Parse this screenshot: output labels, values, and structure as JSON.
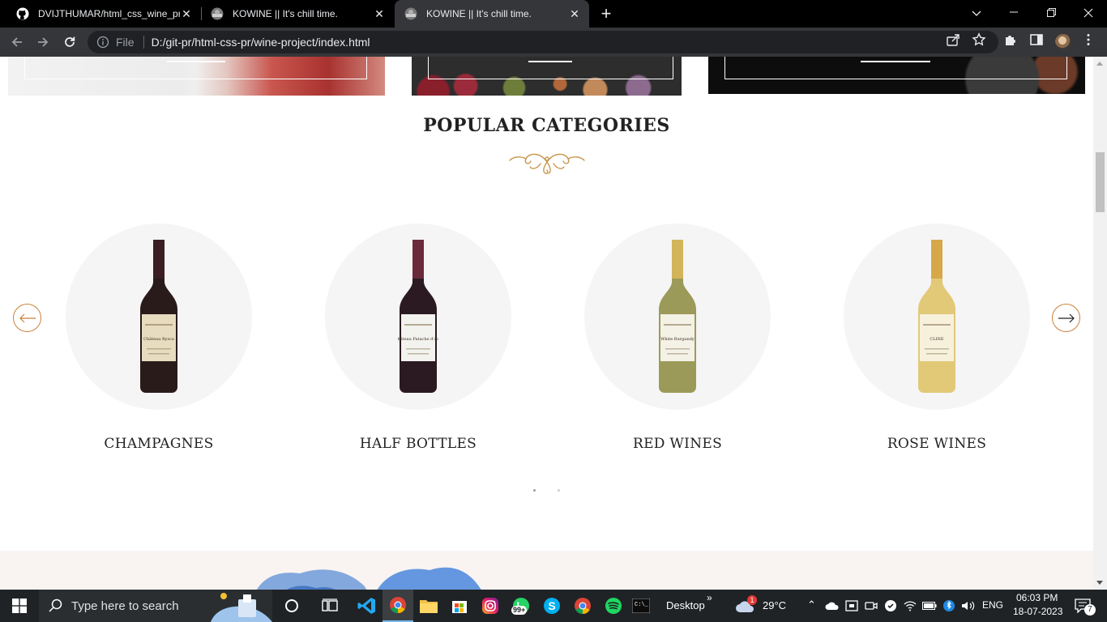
{
  "browser": {
    "tabs": [
      {
        "title": "DVIJTHUMAR/html_css_wine_pro",
        "active": false,
        "favicon": "github-icon"
      },
      {
        "title": "KOWINE || It's chill time.",
        "active": false,
        "favicon": "kowine-favicon"
      },
      {
        "title": "KOWINE || It's chill time.",
        "active": true,
        "favicon": "kowine-favicon"
      }
    ],
    "omnibox": {
      "scheme_label": "File",
      "url": "D:/git-pr/html-css-pr/wine-project/index.html"
    }
  },
  "page": {
    "section_title": "POPULAR CATEGORIES",
    "products": [
      {
        "name": "CHAMPAGNES",
        "bottle_label": "Château Rysca",
        "glass": "#2a1b1b",
        "foil": "#3a1e22",
        "label_bg": "#e8dcc0"
      },
      {
        "name": "HALF BOTTLES",
        "bottle_label": "Château Patache d'Aux",
        "glass": "#2b1a22",
        "foil": "#6a2a3a",
        "label_bg": "#f2f2ee"
      },
      {
        "name": "RED WINES",
        "bottle_label": "White Burgundy",
        "glass": "#9c9a58",
        "foil": "#d2b45a",
        "label_bg": "#f4f1e6"
      },
      {
        "name": "ROSE WINES",
        "bottle_label": "CLINE",
        "glass": "#e2c978",
        "foil": "#d6a84a",
        "label_bg": "#f7f1dc"
      }
    ],
    "accent_color": "#c8813c"
  },
  "taskbar": {
    "search_placeholder": "Type here to search",
    "chrome_badge": "99+",
    "desktop_label": "Desktop",
    "weather": "29°C",
    "weather_badge": "1",
    "language": "ENG",
    "time": "06:03 PM",
    "date": "18-07-2023",
    "notification_count": "7"
  }
}
